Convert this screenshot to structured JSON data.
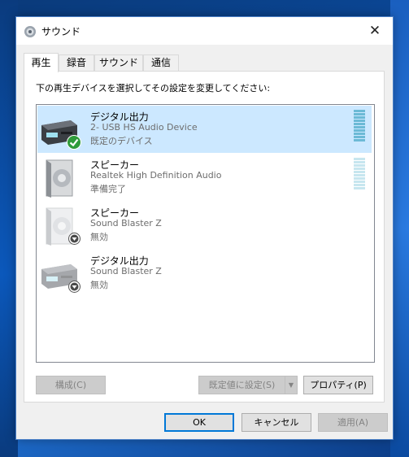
{
  "window": {
    "title": "サウンド",
    "close_glyph": "✕"
  },
  "tabs": [
    {
      "label": "再生",
      "active": true
    },
    {
      "label": "録音",
      "active": false
    },
    {
      "label": "サウンド",
      "active": false
    },
    {
      "label": "通信",
      "active": false
    }
  ],
  "panel": {
    "instruction": "下の再生デバイスを選択してその設定を変更してください:"
  },
  "devices": [
    {
      "name": "デジタル出力",
      "detail": "2- USB HS Audio Device",
      "status": "既定のデバイス",
      "icon": "digital-output-icon",
      "badge": "default-check-icon",
      "selected": true,
      "level": 1.0
    },
    {
      "name": "スピーカー",
      "detail": "Realtek High Definition Audio",
      "status": "準備完了",
      "icon": "speaker-icon",
      "badge": "",
      "selected": false,
      "level": 1.0
    },
    {
      "name": "スピーカー",
      "detail": "Sound Blaster Z",
      "status": "無効",
      "icon": "speaker-icon",
      "badge": "disabled-arrow-icon",
      "selected": false
    },
    {
      "name": "デジタル出力",
      "detail": "Sound Blaster Z",
      "status": "無効",
      "icon": "digital-output-icon",
      "badge": "disabled-arrow-icon",
      "selected": false
    }
  ],
  "buttons": {
    "configure": "構成(C)",
    "set_default": "既定値に設定(S)",
    "set_default_arrow": "▼",
    "properties": "プロパティ(P)",
    "ok": "OK",
    "cancel": "キャンセル",
    "apply": "適用(A)"
  },
  "colors": {
    "selection": "#cce8ff",
    "meter_active": "#6cbad6",
    "meter_idle": "#c7e6ef",
    "accent": "#0078d7"
  }
}
